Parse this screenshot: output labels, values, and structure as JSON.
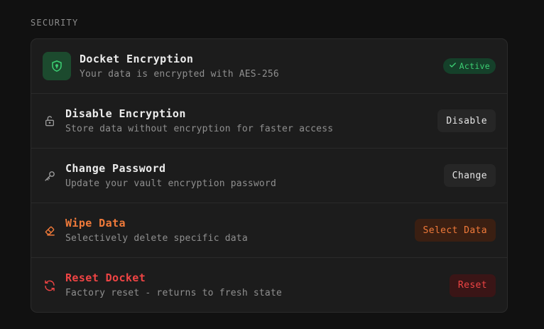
{
  "section": {
    "title": "SECURITY"
  },
  "colors": {
    "success": "#3ccf73",
    "warning": "#f07a3a",
    "danger": "#ef4444",
    "muted": "#8f8f8f"
  },
  "rows": [
    {
      "icon": "shield-lock-icon",
      "title": "Docket Encryption",
      "description": "Your data is encrypted with AES-256",
      "badge": {
        "icon": "check-icon",
        "label": "Active"
      }
    },
    {
      "icon": "unlock-icon",
      "title": "Disable Encryption",
      "description": "Store data without encryption for faster access",
      "button": "Disable"
    },
    {
      "icon": "key-icon",
      "title": "Change Password",
      "description": "Update your vault encryption password",
      "button": "Change"
    },
    {
      "icon": "eraser-icon",
      "title": "Wipe Data",
      "description": "Selectively delete specific data",
      "button": "Select Data"
    },
    {
      "icon": "refresh-icon",
      "title": "Reset Docket",
      "description": "Factory reset - returns to fresh state",
      "button": "Reset"
    }
  ]
}
